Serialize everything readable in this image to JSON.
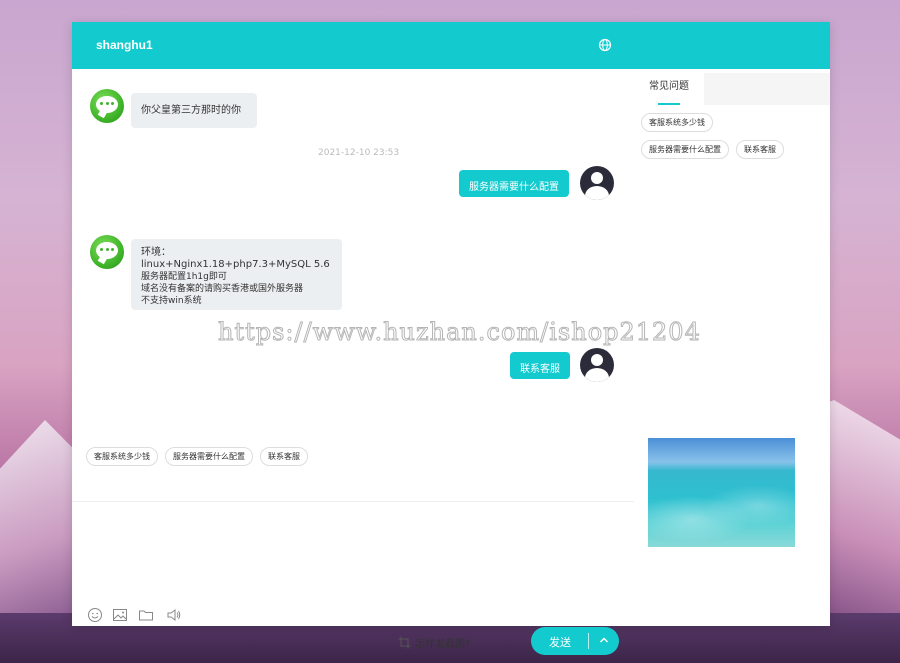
{
  "colors": {
    "accent": "#13cbcf",
    "bot_bubble": "#eceff1"
  },
  "header": {
    "title": "shanghu1",
    "globe_icon": "globe-icon"
  },
  "messages": {
    "bot1": "你父皇第三方那时的你",
    "timestamp": "2021-12-10 23:53",
    "user1": "服务器需要什么配置",
    "bot2": {
      "line1": "环境：linux+Nginx1.18+php7.3+MySQL 5.6",
      "line2": "服务器配置1h1g即可",
      "line3": "域名没有备案的请购买香港或国外服务器",
      "line4": "不支持win系统"
    },
    "user2": "联系客服"
  },
  "quick_replies": [
    "客服系统多少钱",
    "服务器需要什么配置",
    "联系客服"
  ],
  "toolbar": {
    "icons": [
      "emoji-icon",
      "image-icon",
      "folder-icon",
      "volume-icon"
    ],
    "screenshot_link": "怎样发截图?",
    "send_label": "发送"
  },
  "side": {
    "tab_label": "常见问题",
    "faq_row1": [
      "客服系统多少钱"
    ],
    "faq_row2": [
      "服务器需要什么配置",
      "联系客服"
    ]
  },
  "watermark": "https://www.huzhan.com/ishop21204"
}
